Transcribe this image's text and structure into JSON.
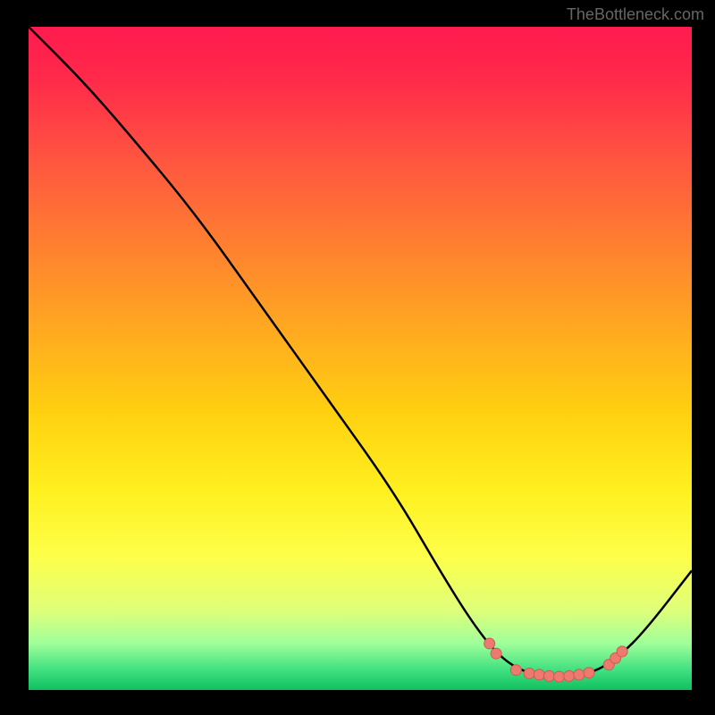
{
  "attribution": "TheBottleneck.com",
  "chart_data": {
    "type": "line",
    "title": "",
    "xlabel": "",
    "ylabel": "",
    "xlim": [
      0,
      100
    ],
    "ylim": [
      0,
      100
    ],
    "curve": [
      {
        "x": 0,
        "y": 100
      },
      {
        "x": 8,
        "y": 92
      },
      {
        "x": 15,
        "y": 84
      },
      {
        "x": 25,
        "y": 72
      },
      {
        "x": 35,
        "y": 58
      },
      {
        "x": 45,
        "y": 44
      },
      {
        "x": 55,
        "y": 30
      },
      {
        "x": 62,
        "y": 18
      },
      {
        "x": 67,
        "y": 10
      },
      {
        "x": 71,
        "y": 5
      },
      {
        "x": 75,
        "y": 2.5
      },
      {
        "x": 80,
        "y": 2
      },
      {
        "x": 85,
        "y": 2.5
      },
      {
        "x": 89,
        "y": 5
      },
      {
        "x": 93,
        "y": 9
      },
      {
        "x": 100,
        "y": 18
      }
    ],
    "markers": [
      {
        "x": 69.5,
        "y": 7.0
      },
      {
        "x": 70.5,
        "y": 5.5
      },
      {
        "x": 73.5,
        "y": 3.0
      },
      {
        "x": 75.5,
        "y": 2.5
      },
      {
        "x": 77.0,
        "y": 2.3
      },
      {
        "x": 78.5,
        "y": 2.1
      },
      {
        "x": 80.0,
        "y": 2.0
      },
      {
        "x": 81.5,
        "y": 2.1
      },
      {
        "x": 83.0,
        "y": 2.3
      },
      {
        "x": 84.5,
        "y": 2.6
      },
      {
        "x": 87.5,
        "y": 3.8
      },
      {
        "x": 88.5,
        "y": 4.8
      },
      {
        "x": 89.5,
        "y": 5.8
      }
    ],
    "colors": {
      "curve_stroke": "#000000",
      "marker_fill": "#ed7a70",
      "marker_stroke": "#d05a50"
    }
  }
}
